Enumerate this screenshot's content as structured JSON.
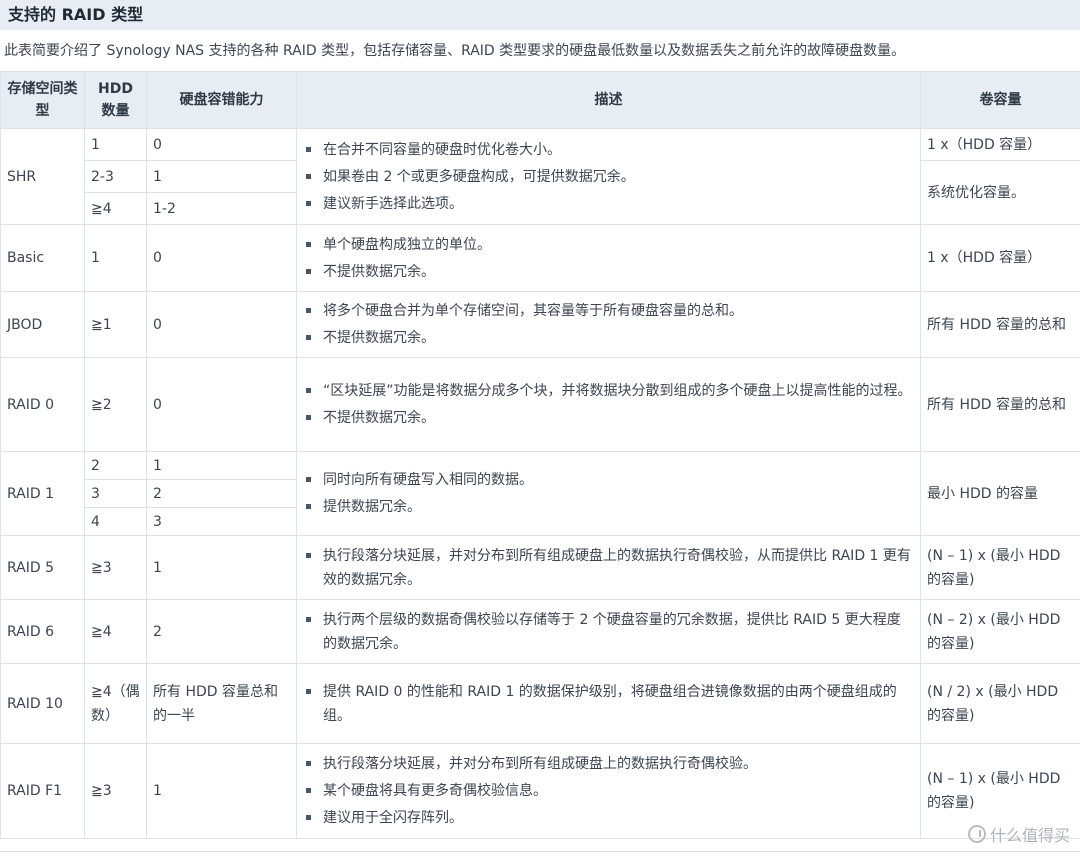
{
  "section_title": "支持的 RAID 类型",
  "intro": "此表简要介绍了 Synology NAS 支持的各种 RAID 类型，包括存储容量、RAID 类型要求的硬盘最低数量以及数据丢失之前允许的故障硬盘数量。",
  "headers": {
    "type": "存储空间类型",
    "hdd_count": "HDD 数量",
    "fault_tolerance": "硬盘容错能力",
    "description": "描述",
    "volume_capacity": "卷容量"
  },
  "rows": {
    "shr": {
      "type": "SHR",
      "hdd": [
        "1",
        "2-3",
        "≧4"
      ],
      "tol": [
        "0",
        "1",
        "1-2"
      ],
      "desc": [
        "在合并不同容量的硬盘时优化卷大小。",
        "如果卷由 2 个或更多硬盘构成，可提供数据冗余。",
        "建议新手选择此选项。"
      ],
      "cap": [
        "1 x（HDD 容量）",
        "系统优化容量。"
      ]
    },
    "basic": {
      "type": "Basic",
      "hdd": "1",
      "tol": "0",
      "desc": [
        "单个硬盘构成独立的单位。",
        "不提供数据冗余。"
      ],
      "cap": "1 x（HDD 容量）"
    },
    "jbod": {
      "type": "JBOD",
      "hdd": "≧1",
      "tol": "0",
      "desc": [
        "将多个硬盘合并为单个存储空间，其容量等于所有硬盘容量的总和。",
        "不提供数据冗余。"
      ],
      "cap": "所有 HDD 容量的总和"
    },
    "raid0": {
      "type": "RAID 0",
      "hdd": "≧2",
      "tol": "0",
      "desc": [
        "“区块延展”功能是将数据分成多个块，并将数据块分散到组成的多个硬盘上以提高性能的过程。",
        "不提供数据冗余。"
      ],
      "cap": "所有 HDD 容量的总和"
    },
    "raid1": {
      "type": "RAID 1",
      "hdd": [
        "2",
        "3",
        "4"
      ],
      "tol": [
        "1",
        "2",
        "3"
      ],
      "desc": [
        "同时向所有硬盘写入相同的数据。",
        "提供数据冗余。"
      ],
      "cap": "最小 HDD 的容量"
    },
    "raid5": {
      "type": "RAID 5",
      "hdd": "≧3",
      "tol": "1",
      "desc": [
        "执行段落分块延展，并对分布到所有组成硬盘上的数据执行奇偶校验，从而提供比 RAID 1 更有效的数据冗余。"
      ],
      "cap": "(N – 1) x (最小 HDD 的容量)"
    },
    "raid6": {
      "type": "RAID 6",
      "hdd": "≧4",
      "tol": "2",
      "desc": [
        "执行两个层级的数据奇偶校验以存储等于 2 个硬盘容量的冗余数据，提供比 RAID 5 更大程度的数据冗余。"
      ],
      "cap": "(N – 2) x (最小 HDD 的容量)"
    },
    "raid10": {
      "type": "RAID 10",
      "hdd": "≧4（偶数）",
      "tol": "所有 HDD 容量总和的一半",
      "desc": [
        "提供 RAID 0 的性能和 RAID 1 的数据保护级别，将硬盘组合进镜像数据的由两个硬盘组成的组。"
      ],
      "cap": "(N / 2) x (最小 HDD 的容量)"
    },
    "raidf1": {
      "type": "RAID F1",
      "hdd": "≧3",
      "tol": "1",
      "desc": [
        "执行段落分块延展，并对分布到所有组成硬盘上的数据执行奇偶校验。",
        "某个硬盘将具有更多奇偶校验信息。",
        "建议用于全闪存阵列。"
      ],
      "cap": "(N – 1) x (最小 HDD 的容量)"
    }
  },
  "watermark": "什么值得买",
  "watermark_icon": "smzdm-logo-icon"
}
